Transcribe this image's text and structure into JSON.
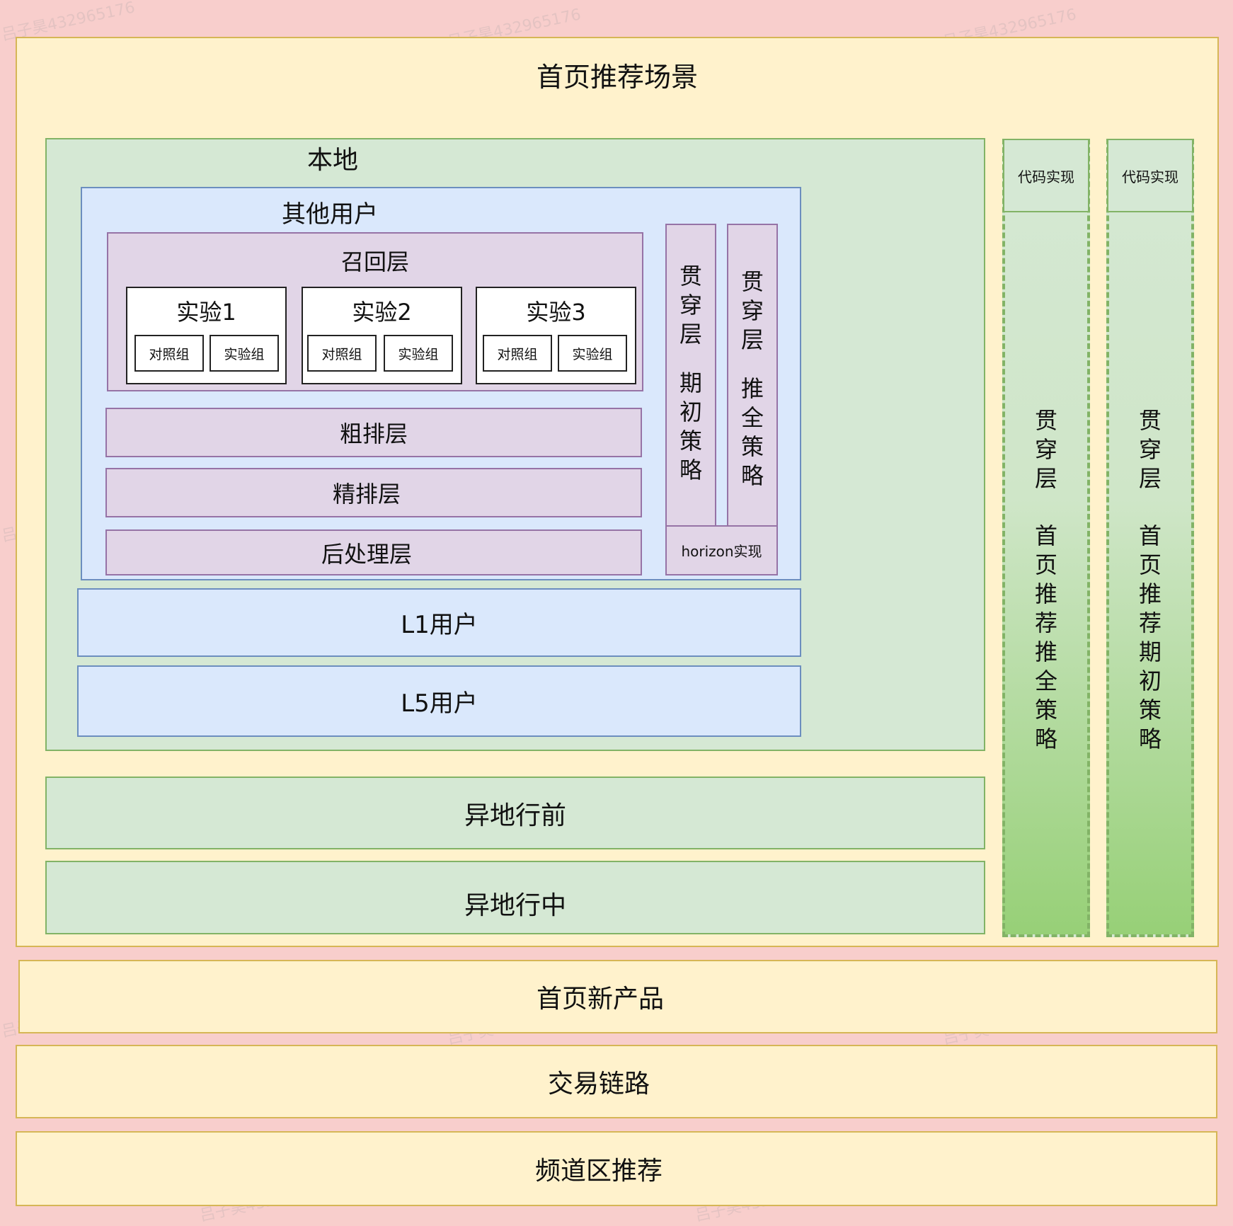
{
  "scene": {
    "title": "首页推荐场景",
    "local": {
      "title": "本地",
      "other_users": {
        "title": "其他用户",
        "recall": {
          "title": "召回层",
          "experiments": [
            {
              "title": "实验1",
              "control": "对照组",
              "test": "实验组"
            },
            {
              "title": "实验2",
              "control": "对照组",
              "test": "实验组"
            },
            {
              "title": "实验3",
              "control": "对照组",
              "test": "实验组"
            }
          ]
        },
        "coarse": "粗排层",
        "fine": "精排层",
        "post": "后处理层",
        "through_a": {
          "chars1": [
            "贯",
            "穿",
            "层"
          ],
          "chars2": [
            "期",
            "初",
            "策",
            "略"
          ]
        },
        "through_b": {
          "chars1": [
            "贯",
            "穿",
            "层"
          ],
          "chars2": [
            "推",
            "全",
            "策",
            "略"
          ]
        },
        "horizon": "horizon实现"
      },
      "l1": "L1用户",
      "l5": "L5用户"
    },
    "remote_before": "异地行前",
    "remote_during": "异地行中",
    "side_columns": [
      {
        "header": "代码实现",
        "chars1": [
          "贯",
          "穿",
          "层"
        ],
        "chars2": [
          "首",
          "页",
          "推",
          "荐",
          "推",
          "全",
          "策",
          "略"
        ]
      },
      {
        "header": "代码实现",
        "chars1": [
          "贯",
          "穿",
          "层"
        ],
        "chars2": [
          "首",
          "页",
          "推",
          "荐",
          "期",
          "初",
          "策",
          "略"
        ]
      }
    ]
  },
  "bottom_rows": [
    "首页新产品",
    "交易链路",
    "频道区推荐"
  ],
  "watermark": "吕子昊432965176"
}
